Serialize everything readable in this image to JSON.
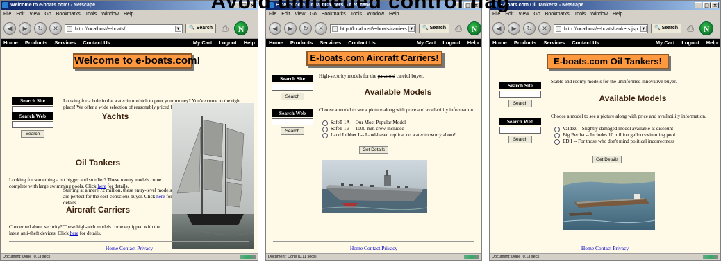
{
  "slide_title": "Avoid unneeded control flag",
  "windows": [
    {
      "title": "Welcome to e-boats.com! - Netscape",
      "menu": [
        "File",
        "Edit",
        "View",
        "Go",
        "Bookmarks",
        "Tools",
        "Window",
        "Help"
      ],
      "url": "http://localhost/e-boats/",
      "search_label": "Search",
      "nav_left": [
        "Home",
        "Products",
        "Services",
        "Contact Us"
      ],
      "nav_right": [
        "My Cart",
        "Logout",
        "Help"
      ],
      "banner": "Welcome to e-boats.com!",
      "search_site": "Search Site",
      "search_web": "Search Web",
      "search_btn": "Search",
      "intro": "Looking for a hole in the water into which to pour your money? You've come to the right place! We offer a wide selection of reasonably priced boats for everyday use.",
      "sections": [
        {
          "heading": "Yachts",
          "text": "Starting at a mere 72 million, these entry-level models are perfect for the cost-conscious buyer. Click ",
          "link": "here",
          "after": " for details."
        },
        {
          "heading": "Oil Tankers",
          "text": "Looking for something a bit bigger and sturdier? These roomy models come complete with large swimming pools. Click ",
          "link": "here",
          "after": " for details."
        },
        {
          "heading": "Aircraft Carriers",
          "text": "Concerned about security? These high-tech models come equipped with the latest anti-theft devices. Click ",
          "link": "here",
          "after": " for details."
        }
      ],
      "footer": [
        "Home",
        "Contact",
        "Privacy"
      ],
      "status": "Document: Done (0.13 secs)"
    },
    {
      "title": "E-boats.com Aircraft Carriers! - Netscape",
      "menu": [
        "File",
        "Edit",
        "View",
        "Go",
        "Bookmarks",
        "Tools",
        "Window",
        "Help"
      ],
      "url": "http://localhost/e-boats/carriers.jsp",
      "search_label": "Search",
      "nav_left": [
        "Home",
        "Products",
        "Services",
        "Contact Us"
      ],
      "nav_right": [
        "My Cart",
        "Logout",
        "Help"
      ],
      "banner": "E-boats.com Aircraft Carriers!",
      "search_site": "Search Site",
      "search_web": "Search Web",
      "search_btn": "Search",
      "tagline_pre": "High-security models for the ",
      "tagline_strike": "paranoid",
      "tagline_post": " careful buyer.",
      "models_heading": "Available Models",
      "choose_text": "Choose a model to see a picture along with price and availability information.",
      "options": [
        "SafeT-1A -- Our Most Popular Model",
        "SafeT-1B -- 1000-mm crew included",
        "Land Lubber I -- Land-based replica; no water to worry about!"
      ],
      "get_details": "Get Details",
      "footer": [
        "Home",
        "Contact",
        "Privacy"
      ],
      "status": "Document: Done (0.11 secs)"
    },
    {
      "title": "E-boats.com Oil Tankers! - Netscape",
      "menu": [
        "File",
        "Edit",
        "View",
        "Go",
        "Bookmarks",
        "Tools",
        "Window",
        "Help"
      ],
      "url": "http://localhost/e-boats/tankers.jsp",
      "search_label": "Search",
      "nav_left": [
        "Home",
        "Products",
        "Services",
        "Contact Us"
      ],
      "nav_right": [
        "My Cart",
        "Logout",
        "Help"
      ],
      "banner": "E-boats.com Oil Tankers!",
      "search_site": "Search Site",
      "search_web": "Search Web",
      "search_btn": "Search",
      "tagline_pre": "Stable and roomy models for the ",
      "tagline_strike": "uninformed",
      "tagline_post": " innovative buyer.",
      "models_heading": "Available Models",
      "choose_text": "Choose a model to see a picture along with price and availability information.",
      "options": [
        "Valdez -- Slightly damaged model available at discount",
        "Big Bertha -- Includes 10 million gallon swimming pool",
        "ED I -- For those who don't mind political incorrectness"
      ],
      "get_details": "Get Details",
      "footer": [
        "Home",
        "Contact",
        "Privacy"
      ],
      "status": "Document: Done (0.13 secs)"
    }
  ]
}
